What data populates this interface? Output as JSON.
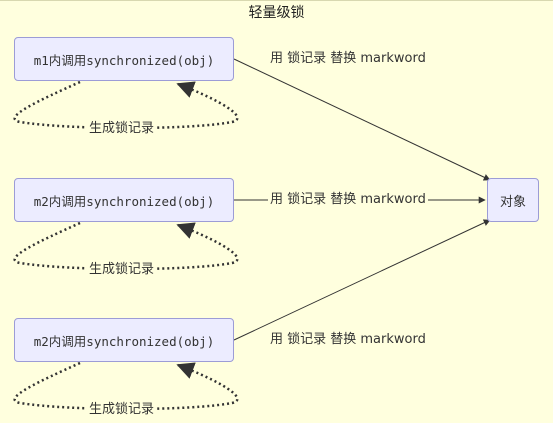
{
  "title": "轻量级锁",
  "nodes": {
    "m1": "m1内调用synchronized(obj)",
    "m2a": "m2内调用synchronized(obj)",
    "m2b": "m2内调用synchronized(obj)",
    "target": "对象"
  },
  "edge_labels": {
    "replace": "用 锁记录 替换 markword",
    "loop": "生成锁记录"
  },
  "colors": {
    "background": "#ffffde",
    "node_fill": "#ececff",
    "node_border": "#9c9cd6",
    "edge": "#333333"
  }
}
